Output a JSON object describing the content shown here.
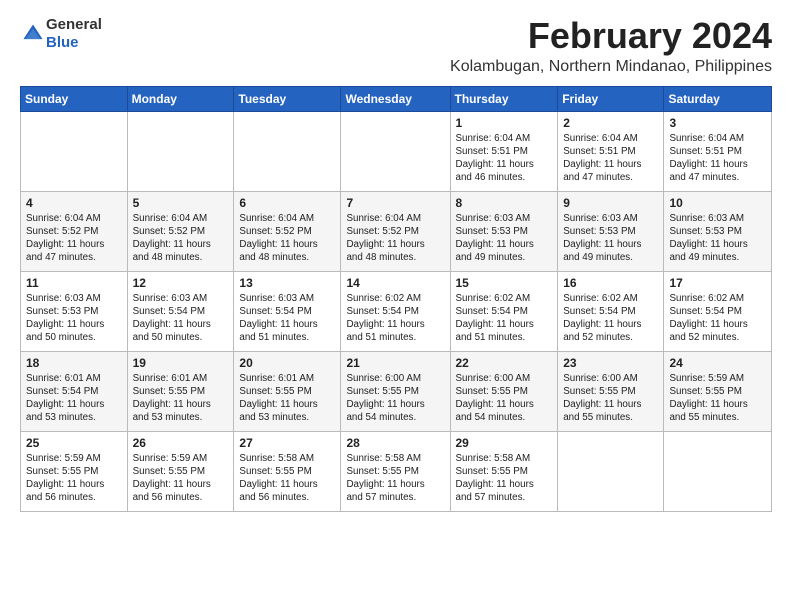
{
  "logo": {
    "general": "General",
    "blue": "Blue"
  },
  "title": {
    "month": "February 2024",
    "location": "Kolambugan, Northern Mindanao, Philippines"
  },
  "headers": [
    "Sunday",
    "Monday",
    "Tuesday",
    "Wednesday",
    "Thursday",
    "Friday",
    "Saturday"
  ],
  "weeks": [
    [
      {
        "day": "",
        "info": ""
      },
      {
        "day": "",
        "info": ""
      },
      {
        "day": "",
        "info": ""
      },
      {
        "day": "",
        "info": ""
      },
      {
        "day": "1",
        "info": "Sunrise: 6:04 AM\nSunset: 5:51 PM\nDaylight: 11 hours\nand 46 minutes."
      },
      {
        "day": "2",
        "info": "Sunrise: 6:04 AM\nSunset: 5:51 PM\nDaylight: 11 hours\nand 47 minutes."
      },
      {
        "day": "3",
        "info": "Sunrise: 6:04 AM\nSunset: 5:51 PM\nDaylight: 11 hours\nand 47 minutes."
      }
    ],
    [
      {
        "day": "4",
        "info": "Sunrise: 6:04 AM\nSunset: 5:52 PM\nDaylight: 11 hours\nand 47 minutes."
      },
      {
        "day": "5",
        "info": "Sunrise: 6:04 AM\nSunset: 5:52 PM\nDaylight: 11 hours\nand 48 minutes."
      },
      {
        "day": "6",
        "info": "Sunrise: 6:04 AM\nSunset: 5:52 PM\nDaylight: 11 hours\nand 48 minutes."
      },
      {
        "day": "7",
        "info": "Sunrise: 6:04 AM\nSunset: 5:52 PM\nDaylight: 11 hours\nand 48 minutes."
      },
      {
        "day": "8",
        "info": "Sunrise: 6:03 AM\nSunset: 5:53 PM\nDaylight: 11 hours\nand 49 minutes."
      },
      {
        "day": "9",
        "info": "Sunrise: 6:03 AM\nSunset: 5:53 PM\nDaylight: 11 hours\nand 49 minutes."
      },
      {
        "day": "10",
        "info": "Sunrise: 6:03 AM\nSunset: 5:53 PM\nDaylight: 11 hours\nand 49 minutes."
      }
    ],
    [
      {
        "day": "11",
        "info": "Sunrise: 6:03 AM\nSunset: 5:53 PM\nDaylight: 11 hours\nand 50 minutes."
      },
      {
        "day": "12",
        "info": "Sunrise: 6:03 AM\nSunset: 5:54 PM\nDaylight: 11 hours\nand 50 minutes."
      },
      {
        "day": "13",
        "info": "Sunrise: 6:03 AM\nSunset: 5:54 PM\nDaylight: 11 hours\nand 51 minutes."
      },
      {
        "day": "14",
        "info": "Sunrise: 6:02 AM\nSunset: 5:54 PM\nDaylight: 11 hours\nand 51 minutes."
      },
      {
        "day": "15",
        "info": "Sunrise: 6:02 AM\nSunset: 5:54 PM\nDaylight: 11 hours\nand 51 minutes."
      },
      {
        "day": "16",
        "info": "Sunrise: 6:02 AM\nSunset: 5:54 PM\nDaylight: 11 hours\nand 52 minutes."
      },
      {
        "day": "17",
        "info": "Sunrise: 6:02 AM\nSunset: 5:54 PM\nDaylight: 11 hours\nand 52 minutes."
      }
    ],
    [
      {
        "day": "18",
        "info": "Sunrise: 6:01 AM\nSunset: 5:54 PM\nDaylight: 11 hours\nand 53 minutes."
      },
      {
        "day": "19",
        "info": "Sunrise: 6:01 AM\nSunset: 5:55 PM\nDaylight: 11 hours\nand 53 minutes."
      },
      {
        "day": "20",
        "info": "Sunrise: 6:01 AM\nSunset: 5:55 PM\nDaylight: 11 hours\nand 53 minutes."
      },
      {
        "day": "21",
        "info": "Sunrise: 6:00 AM\nSunset: 5:55 PM\nDaylight: 11 hours\nand 54 minutes."
      },
      {
        "day": "22",
        "info": "Sunrise: 6:00 AM\nSunset: 5:55 PM\nDaylight: 11 hours\nand 54 minutes."
      },
      {
        "day": "23",
        "info": "Sunrise: 6:00 AM\nSunset: 5:55 PM\nDaylight: 11 hours\nand 55 minutes."
      },
      {
        "day": "24",
        "info": "Sunrise: 5:59 AM\nSunset: 5:55 PM\nDaylight: 11 hours\nand 55 minutes."
      }
    ],
    [
      {
        "day": "25",
        "info": "Sunrise: 5:59 AM\nSunset: 5:55 PM\nDaylight: 11 hours\nand 56 minutes."
      },
      {
        "day": "26",
        "info": "Sunrise: 5:59 AM\nSunset: 5:55 PM\nDaylight: 11 hours\nand 56 minutes."
      },
      {
        "day": "27",
        "info": "Sunrise: 5:58 AM\nSunset: 5:55 PM\nDaylight: 11 hours\nand 56 minutes."
      },
      {
        "day": "28",
        "info": "Sunrise: 5:58 AM\nSunset: 5:55 PM\nDaylight: 11 hours\nand 57 minutes."
      },
      {
        "day": "29",
        "info": "Sunrise: 5:58 AM\nSunset: 5:55 PM\nDaylight: 11 hours\nand 57 minutes."
      },
      {
        "day": "",
        "info": ""
      },
      {
        "day": "",
        "info": ""
      }
    ]
  ]
}
